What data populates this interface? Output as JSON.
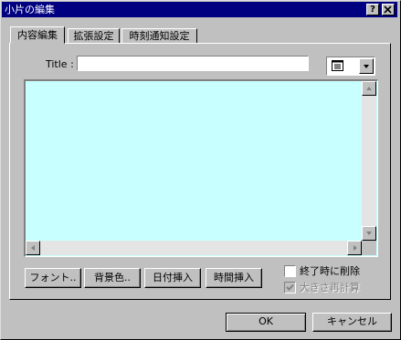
{
  "window": {
    "title": "小片の編集",
    "help_label": "?",
    "close_label": "×"
  },
  "tabs": [
    {
      "label": "内容編集",
      "active": true
    },
    {
      "label": "拡張設定",
      "active": false
    },
    {
      "label": "時刻通知設定",
      "active": false
    }
  ],
  "content": {
    "title_label": "Title :",
    "title_value": "",
    "view_icon": "list-view-icon",
    "body_text": "",
    "body_bg_color": "#c8ffff"
  },
  "buttons": {
    "font": "フォント..",
    "bgcolor": "背景色..",
    "insert_date": "日付挿入",
    "insert_time": "時間挿入"
  },
  "options": {
    "delete_on_exit": {
      "label": "終了時に削除",
      "checked": false,
      "enabled": true
    },
    "auto_size": {
      "label": "大きさ再計算",
      "checked": true,
      "enabled": false
    }
  },
  "dialog": {
    "ok": "OK",
    "cancel": "キャンセル"
  }
}
